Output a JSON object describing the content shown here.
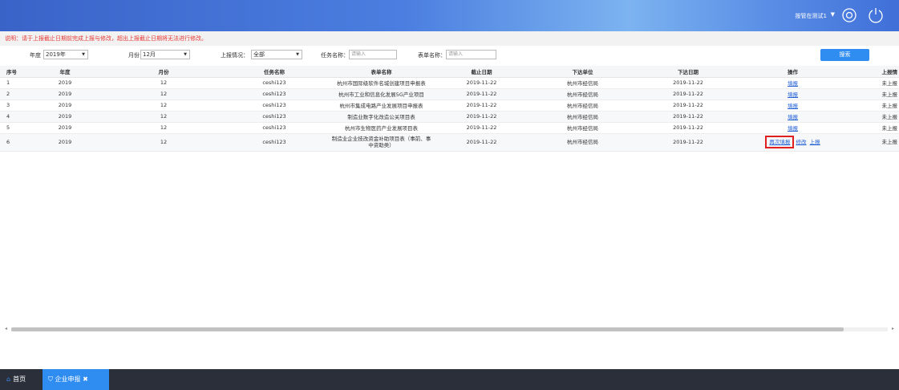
{
  "header": {
    "user_name": "按管在测试1",
    "dropdown_arrow": "▼",
    "settings_icon": "settings-icon",
    "power_icon": "power-icon"
  },
  "notice": "说明：请于上报截止日期前完成上报与修改，超出上报截止日期将无法进行修改。",
  "filters": {
    "year_label": "年度",
    "year_value": "2019年",
    "month_label": "月份",
    "month_value": "12月",
    "report_status_label": "上报情况：",
    "report_status_value": "全部",
    "task_name_label": "任务名称：",
    "task_name_placeholder": "请输入",
    "form_name_label": "表单名称：",
    "form_name_placeholder": "请输入",
    "search_button": "搜索"
  },
  "table": {
    "headers": [
      "序号",
      "年度",
      "月份",
      "任务名称",
      "表单名称",
      "截止日期",
      "下达单位",
      "下达日期",
      "操作",
      "上报情"
    ],
    "rows": [
      {
        "no": "1",
        "year": "2019",
        "month": "12",
        "task": "ceshi123",
        "form": "杭州市国际级软件名城创建项目申报表",
        "deadline": "2019-11-22",
        "unit": "杭州市经信局",
        "issue_date": "2019-11-22",
        "action": "填报",
        "status": "未上报"
      },
      {
        "no": "2",
        "year": "2019",
        "month": "12",
        "task": "ceshi123",
        "form": "杭州市工业和信息化发展5G产业项目",
        "deadline": "2019-11-22",
        "unit": "杭州市经信局",
        "issue_date": "2019-11-22",
        "action": "填报",
        "status": "未上报"
      },
      {
        "no": "3",
        "year": "2019",
        "month": "12",
        "task": "ceshi123",
        "form": "杭州市集成电路产业发展项目申报表",
        "deadline": "2019-11-22",
        "unit": "杭州市经信局",
        "issue_date": "2019-11-22",
        "action": "填报",
        "status": "未上报"
      },
      {
        "no": "4",
        "year": "2019",
        "month": "12",
        "task": "ceshi123",
        "form": "制造业数字化改造公关项目表",
        "deadline": "2019-11-22",
        "unit": "杭州市经信局",
        "issue_date": "2019-11-22",
        "action": "填报",
        "status": "未上报"
      },
      {
        "no": "5",
        "year": "2019",
        "month": "12",
        "task": "ceshi123",
        "form": "杭州市生物医药产业发展项目表",
        "deadline": "2019-11-22",
        "unit": "杭州市经信局",
        "issue_date": "2019-11-22",
        "action": "填报",
        "status": "未上报"
      },
      {
        "no": "6",
        "year": "2019",
        "month": "12",
        "task": "ceshi123",
        "form": "制造业企业技改资金补助项目表（事前、事中资助类）",
        "deadline": "2019-11-22",
        "unit": "杭州市经信局",
        "issue_date": "2019-11-22",
        "action": "再次填报",
        "action2": "修改",
        "action3": "上报",
        "status": "未上报"
      }
    ]
  },
  "bottom_tabs": {
    "home_label": "首页",
    "active_label": "企业申报",
    "close": "✖"
  },
  "colors": {
    "header_blue": "#3a63c8",
    "accent": "#2f8cf0",
    "notice_red": "#e53935",
    "highlight_red": "#e02020",
    "bottom_bar": "#2a2f3a"
  }
}
